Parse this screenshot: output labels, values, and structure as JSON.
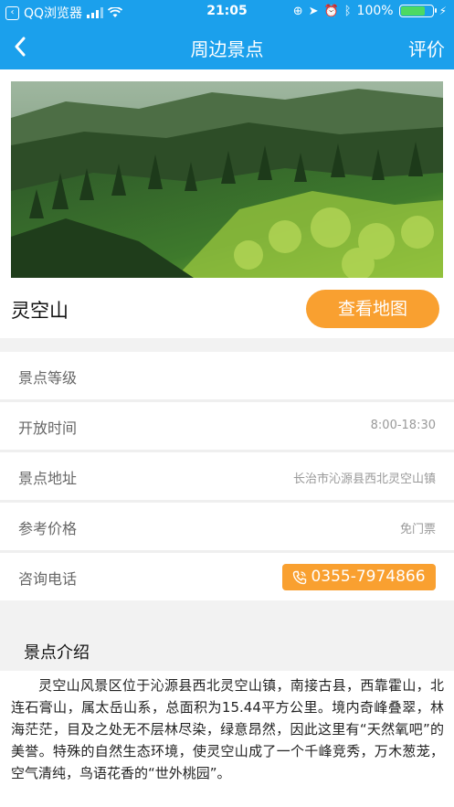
{
  "status_bar": {
    "app": "QQ浏览器",
    "time": "21:05",
    "battery": "100%"
  },
  "nav": {
    "title": "周边景点",
    "right_action": "评价",
    "back_icon": "chevron-left-icon"
  },
  "spot": {
    "name": "灵空山",
    "map_button": "查看地图"
  },
  "details": [
    {
      "label": "景点等级",
      "value": ""
    },
    {
      "label": "开放时间",
      "value": "8:00-18:30"
    },
    {
      "label": "景点地址",
      "value": "长治市沁源县西北灵空山镇"
    },
    {
      "label": "参考价格",
      "value": "免门票"
    },
    {
      "label": "咨询电话",
      "value": "0355-7974866"
    }
  ],
  "intro": {
    "heading": "景点介绍",
    "text": "灵空山风景区位于沁源县西北灵空山镇，南接古县，西靠霍山，北连石膏山，属太岳山系，总面积为15.44平方公里。境内奇峰叠翠，林海茫茫，目及之处无不层林尽染，绿意昂然，因此这里有“天然氧吧”的美誉。特殊的自然生态环境，使灵空山成了一个千峰竞秀，万木葱茏，空气清纯，鸟语花香的“世外桃园”。"
  },
  "colors": {
    "primary": "#1ba0ec",
    "accent": "#f9a030",
    "battery": "#4cd964"
  }
}
